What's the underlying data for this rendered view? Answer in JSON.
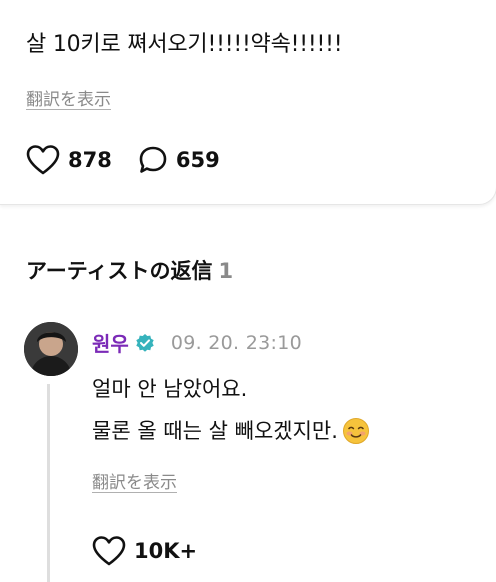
{
  "post": {
    "text": "살 10키로 쪄서오기!!!!!약속!!!!!!",
    "translate_label": "翻訳を表示",
    "like_count": "878",
    "comment_count": "659"
  },
  "artist_replies": {
    "title": "アーティストの返信",
    "count": "1"
  },
  "reply": {
    "username": "원우",
    "timestamp": "09. 20. 23:10",
    "line1": "얼마 안 남았어요.",
    "line2": "물론 올 때는 살 빼오겠지만.",
    "translate_label": "翻訳を表示",
    "like_count": "10K+"
  },
  "icons": {
    "like": "heart-outline-icon",
    "comment": "speech-bubble-icon",
    "verified": "verified-badge-icon",
    "emoji": "smiling-face-emoji-icon"
  },
  "colors": {
    "username": "#7b2ab7",
    "verified_badge": "#36b3bc",
    "muted_text": "#8a8a8a"
  }
}
